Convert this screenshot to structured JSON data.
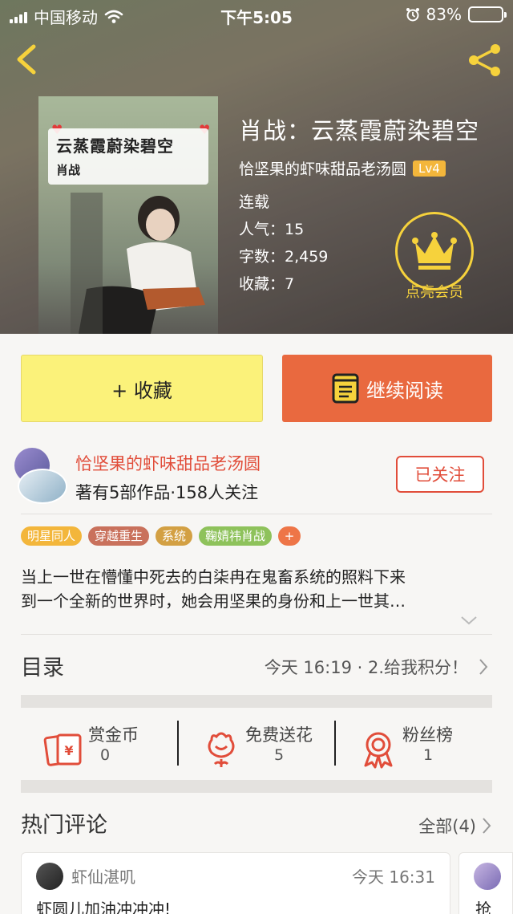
{
  "status_bar": {
    "carrier": "中国移动",
    "time": "下午5:05",
    "battery": "83%",
    "battery_level": 0.83
  },
  "book": {
    "title": "肖战：云蒸霞蔚染碧空",
    "author": "恰坚果的虾味甜品老汤圆",
    "author_level": "Lv4",
    "status": "连载",
    "popularity": "人气：15",
    "word_count": "字数：2,459",
    "favorites": "收藏：7",
    "cover": {
      "title_text": "云蒸霞蔚染碧空",
      "subtitle_text": "肖战"
    }
  },
  "vip": {
    "label": "点亮会员"
  },
  "actions": {
    "favorite_label": "+ 收藏",
    "continue_label": "继续阅读"
  },
  "author_card": {
    "name": "恰坚果的虾味甜品老汤圆",
    "subtitle": "著有5部作品·158人关注",
    "follow_label": "已关注"
  },
  "tags": [
    {
      "label": "明星同人",
      "color": "#f3b63b"
    },
    {
      "label": "穿越重生",
      "color": "#c9715c"
    },
    {
      "label": "系统",
      "color": "#d3a043"
    },
    {
      "label": "鞠婧祎肖战",
      "color": "#8ec25b"
    },
    {
      "label": "+",
      "color": "#ee7547"
    }
  ],
  "summary": {
    "line1": "当上一世在懵懂中死去的白柒冉在鬼畜系统的照料下来",
    "line2": "到一个全新的世界时，她会用坚果的身份和上一世其…"
  },
  "toc": {
    "label": "目录",
    "latest": "今天 16:19 · 2.给我积分！"
  },
  "stats": [
    {
      "label": "赏金币",
      "value": "0",
      "icon": "reward-coin-icon"
    },
    {
      "label": "免费送花",
      "value": "5",
      "icon": "flower-icon"
    },
    {
      "label": "粉丝榜",
      "value": "1",
      "icon": "fan-rank-ribbon-icon"
    }
  ],
  "comments": {
    "title": "热门评论",
    "all_label": "全部(4)",
    "items": [
      {
        "user": "虾仙湛叽",
        "time": "今天 16:31",
        "text": "虾圆儿加油冲冲冲!"
      },
      {
        "text": "抢"
      }
    ]
  },
  "colors": {
    "accent_red": "#e14d3a",
    "continue_orange": "#e9693f",
    "favorite_yellow": "#fbf27a",
    "vip_gold": "#f6d23c"
  }
}
